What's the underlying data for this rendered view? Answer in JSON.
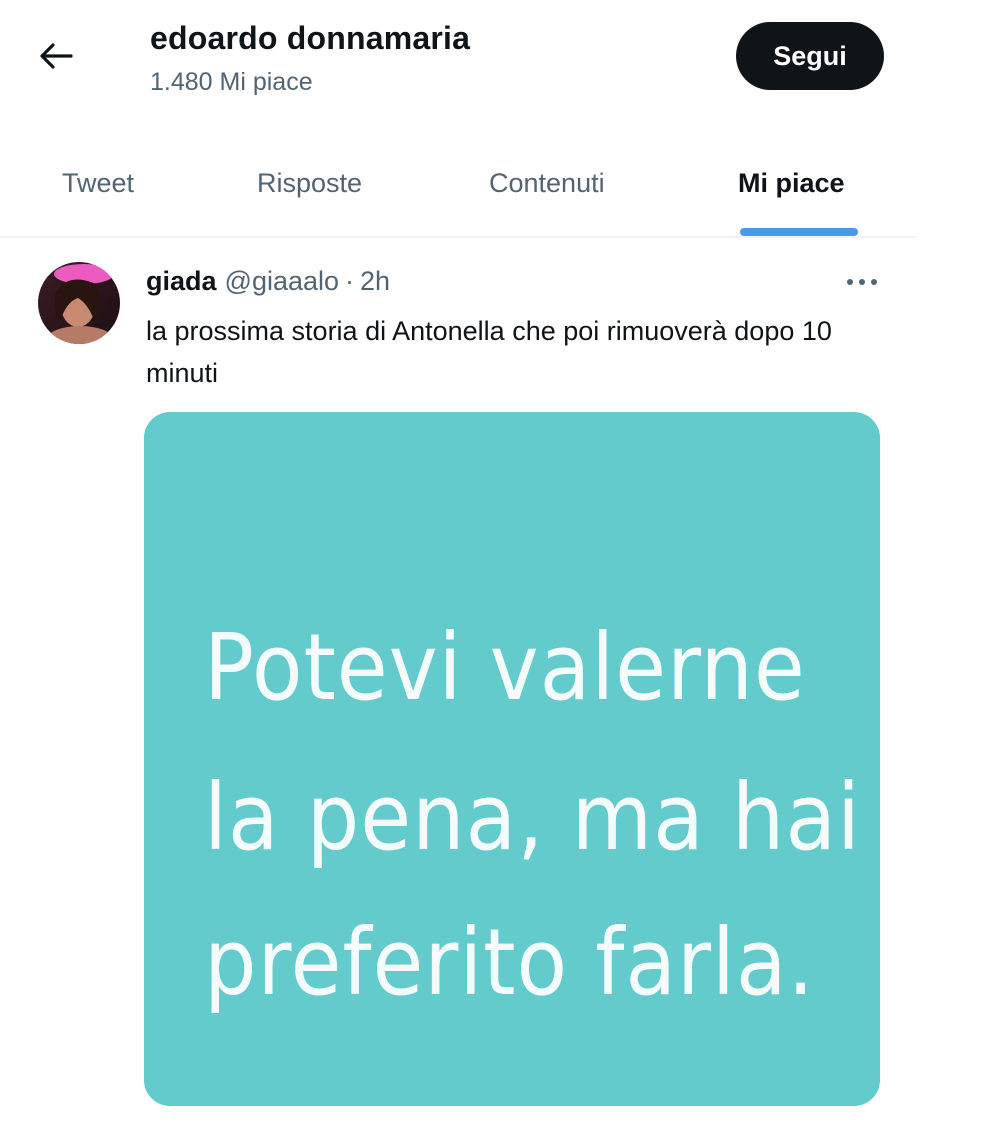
{
  "header": {
    "back_icon": "arrow-left-icon",
    "profile_name": "edoardo donnamaria",
    "likes_count": "1.480 Mi piace",
    "follow_label": "Segui"
  },
  "tabs": [
    {
      "label": "Tweet",
      "active": false
    },
    {
      "label": "Risposte",
      "active": false
    },
    {
      "label": "Contenuti",
      "active": false
    },
    {
      "label": "Mi piace",
      "active": true
    }
  ],
  "tweet": {
    "author": "giada",
    "handle": "@giaaalo",
    "separator": "·",
    "time": "2h",
    "more_icon": "more-dots-icon",
    "text": "la prossima storia di Antonella che poi rimuoverà dopo 10 minuti",
    "media": {
      "background_color": "#64cbcc",
      "lines": [
        "Potevi valerne",
        "la pena, ma hai",
        "preferito farla."
      ]
    }
  },
  "colors": {
    "accent": "#4a99e9",
    "text_primary": "#0f1419",
    "text_secondary": "#536471",
    "button_bg": "#0f1419"
  }
}
